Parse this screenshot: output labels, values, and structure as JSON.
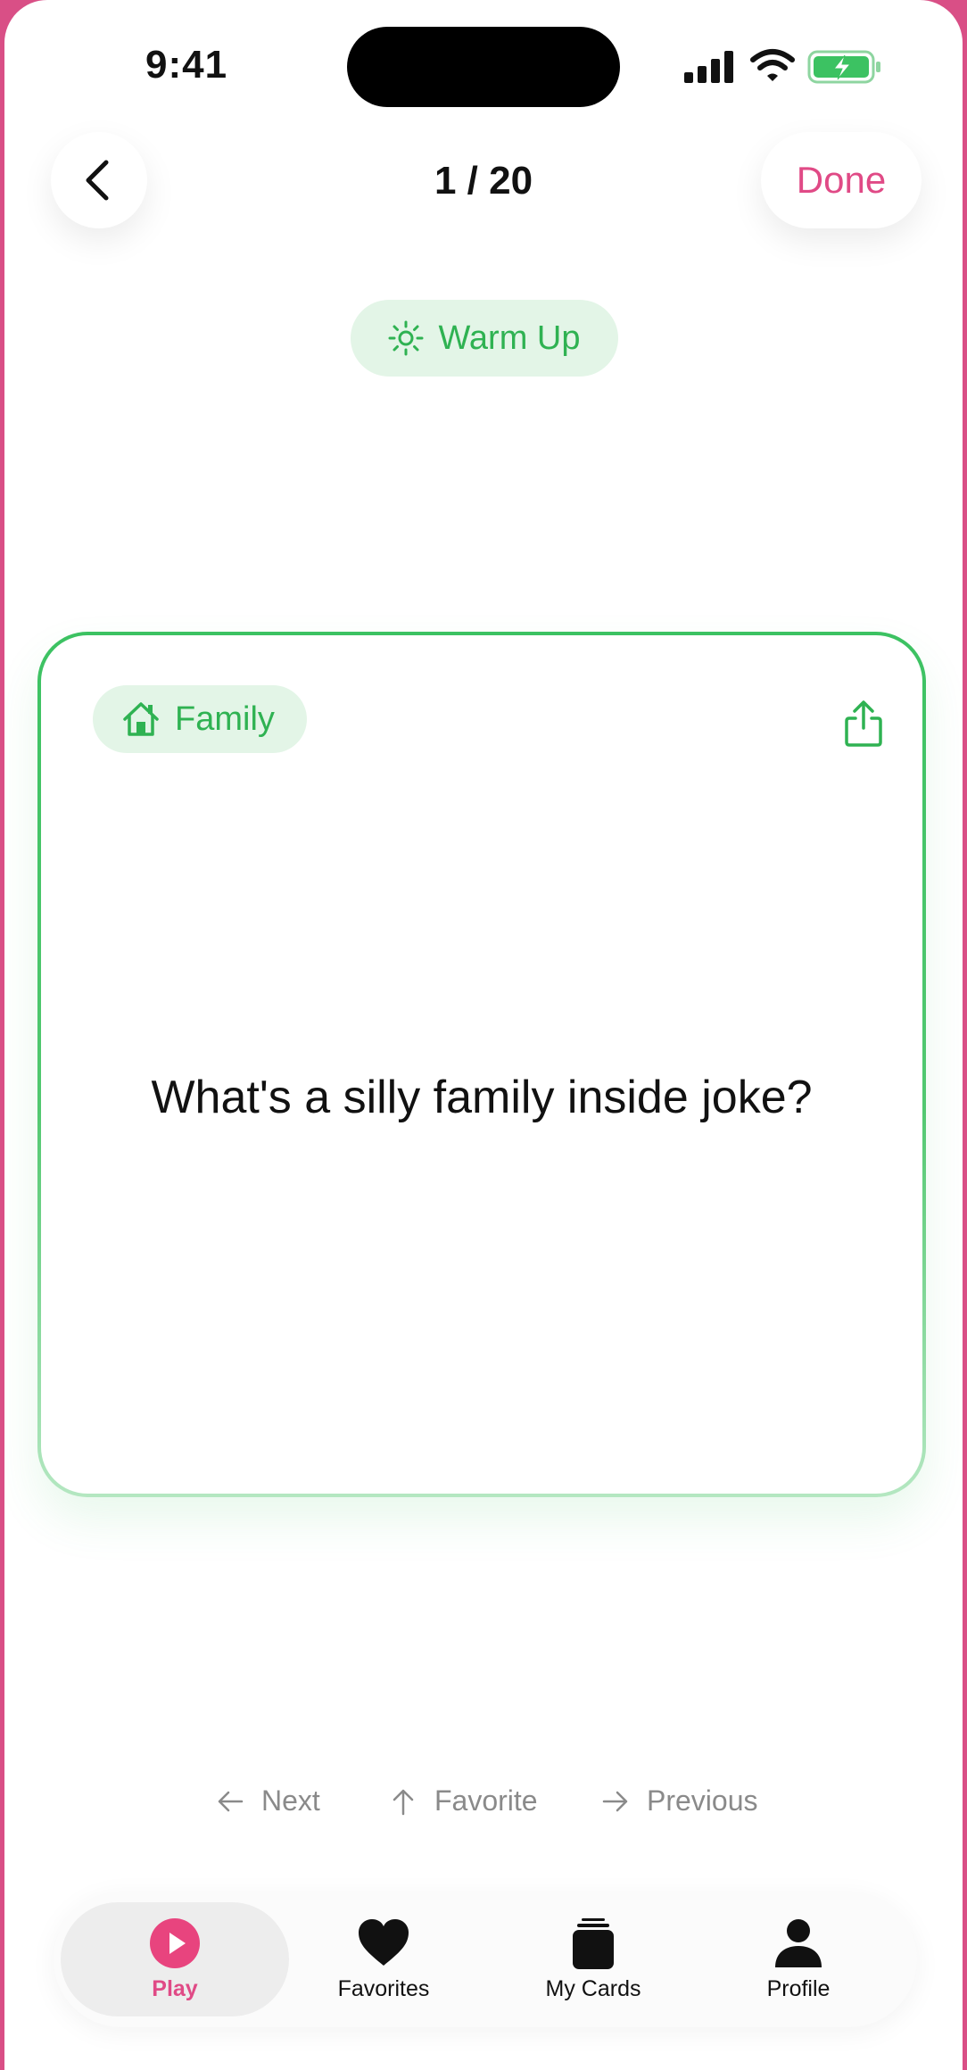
{
  "status_bar": {
    "time": "9:41"
  },
  "header": {
    "counter": "1 / 20",
    "done_label": "Done"
  },
  "category_pill": {
    "label": "Warm Up",
    "icon": "sun-icon"
  },
  "card": {
    "tag": {
      "label": "Family",
      "icon": "house-icon"
    },
    "question": "What's a silly family inside joke?",
    "accent_color": "#3cc262"
  },
  "hints": [
    {
      "label": "Next",
      "icon": "arrow-left-icon"
    },
    {
      "label": "Favorite",
      "icon": "arrow-up-icon"
    },
    {
      "label": "Previous",
      "icon": "arrow-right-icon"
    }
  ],
  "tabs": [
    {
      "label": "Play",
      "icon": "play-icon",
      "active": true
    },
    {
      "label": "Favorites",
      "icon": "heart-icon"
    },
    {
      "label": "My Cards",
      "icon": "cards-icon"
    },
    {
      "label": "Profile",
      "icon": "person-icon"
    }
  ],
  "colors": {
    "brand_pink": "#e04a86",
    "green": "#2fb252",
    "green_bg": "#e3f5e7"
  }
}
